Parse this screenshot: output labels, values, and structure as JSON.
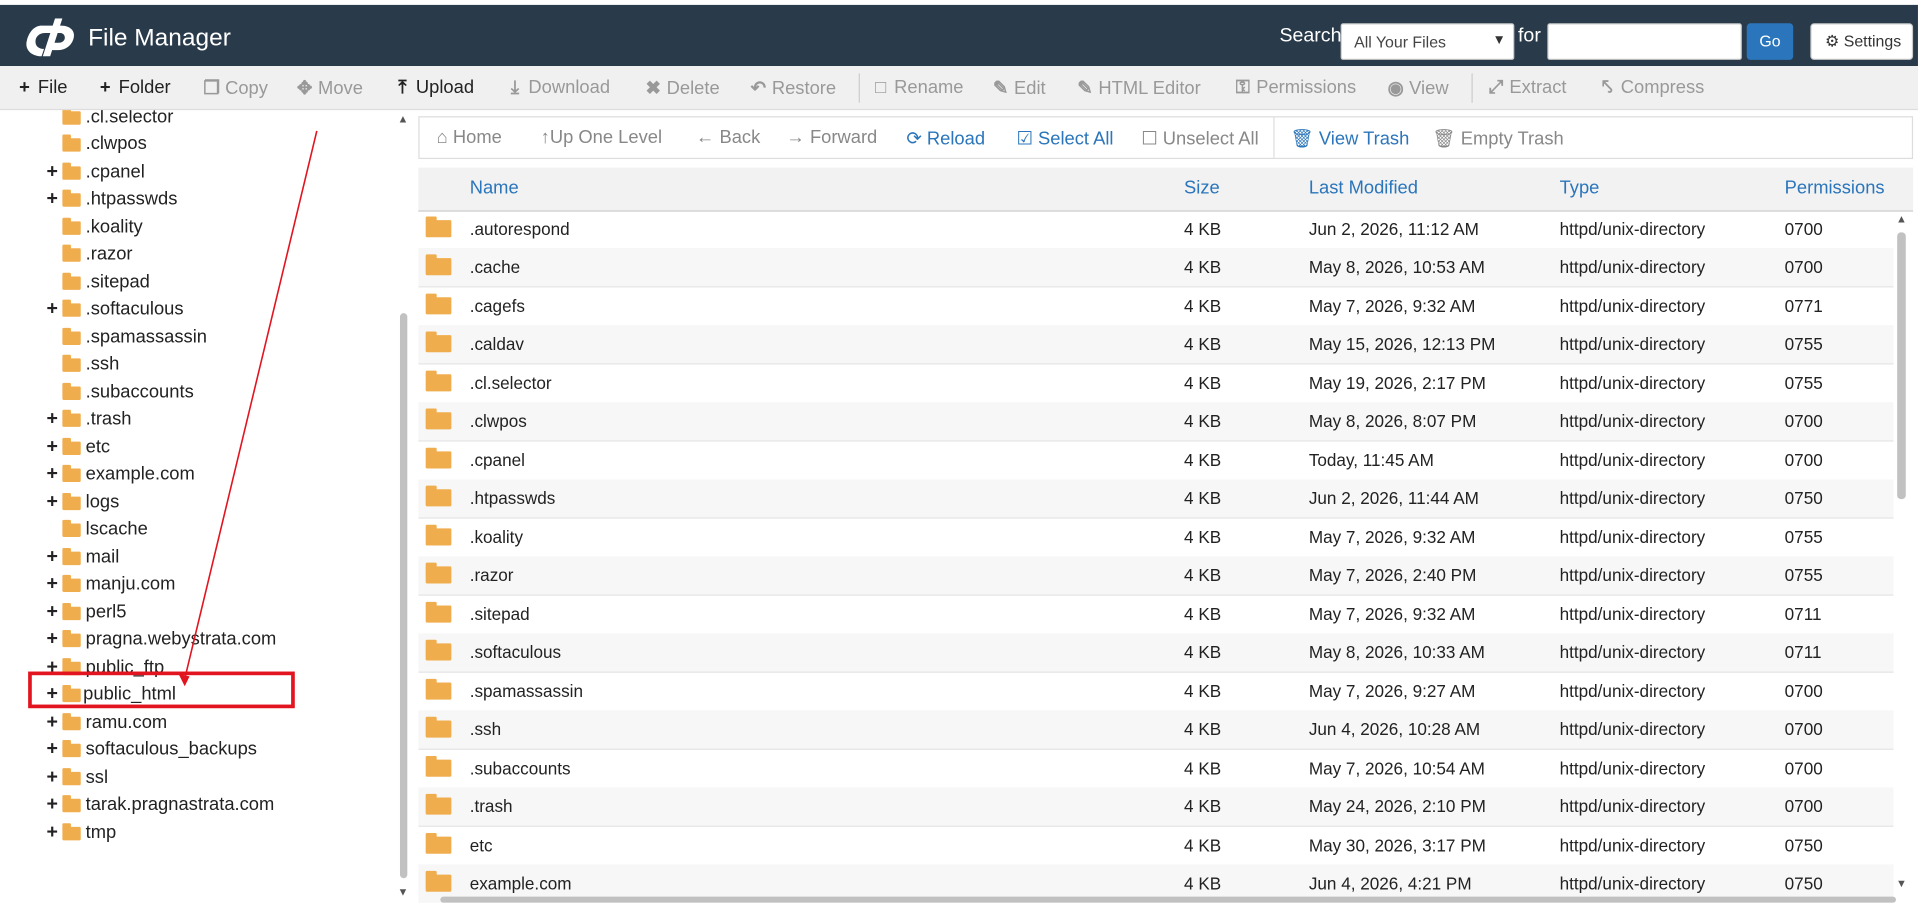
{
  "header": {
    "title": "File Manager",
    "search_label": "Search",
    "search_scope": "All Your Files",
    "for_label": "for",
    "search_value": "",
    "go_label": "Go",
    "settings_label": "Settings",
    "bg_color": "#293a4a"
  },
  "toolbar": {
    "items": [
      {
        "label": "File",
        "icon": "plus-icon"
      },
      {
        "label": "Folder",
        "icon": "plus-icon"
      },
      {
        "label": "Copy",
        "icon": "copy-icon"
      },
      {
        "label": "Move",
        "icon": "move-icon"
      },
      {
        "label": "Upload",
        "icon": "upload-icon"
      },
      {
        "label": "Download",
        "icon": "download-icon"
      },
      {
        "label": "Delete",
        "icon": "close-icon"
      },
      {
        "label": "Restore",
        "icon": "undo-icon"
      },
      {
        "label": "Rename",
        "icon": "file-icon"
      },
      {
        "label": "Edit",
        "icon": "pencil-icon"
      },
      {
        "label": "HTML Editor",
        "icon": "edit-icon"
      },
      {
        "label": "Permissions",
        "icon": "key-icon"
      },
      {
        "label": "View",
        "icon": "eye-icon"
      },
      {
        "label": "Extract",
        "icon": "expand-icon"
      },
      {
        "label": "Compress",
        "icon": "compress-icon"
      }
    ]
  },
  "tree": {
    "items": [
      {
        "label": ".cl.selector"
      },
      {
        "label": ".clwpos"
      },
      {
        "label": ".cpanel"
      },
      {
        "label": ".htpasswds"
      },
      {
        "label": ".koality"
      },
      {
        "label": ".razor"
      },
      {
        "label": ".sitepad"
      },
      {
        "label": ".softaculous"
      },
      {
        "label": ".spamassassin"
      },
      {
        "label": ".ssh"
      },
      {
        "label": ".subaccounts"
      },
      {
        "label": ".trash"
      },
      {
        "label": "etc"
      },
      {
        "label": "example.com"
      },
      {
        "label": "logs"
      },
      {
        "label": "lscache"
      },
      {
        "label": "mail"
      },
      {
        "label": "manju.com"
      },
      {
        "label": "perl5"
      },
      {
        "label": "pragna.webystrata.com"
      },
      {
        "label": "public_ftp"
      },
      {
        "label": "public_html"
      },
      {
        "label": "ramu.com"
      },
      {
        "label": "softaculous_backups"
      },
      {
        "label": "ssl"
      },
      {
        "label": "tarak.pragnastrata.com"
      },
      {
        "label": "tmp"
      }
    ]
  },
  "navbar": {
    "items": [
      {
        "label": "Home",
        "icon": "home-icon"
      },
      {
        "label": "Up One Level",
        "icon": "arrow-up-icon"
      },
      {
        "label": "Back",
        "icon": "arrow-left-icon"
      },
      {
        "label": "Forward",
        "icon": "arrow-right-icon"
      },
      {
        "label": "Reload",
        "icon": "reload-icon"
      },
      {
        "label": "Select All",
        "icon": "checkbox-checked-icon"
      },
      {
        "label": "Unselect All",
        "icon": "checkbox-empty-icon"
      },
      {
        "label": "View Trash",
        "icon": "trash-icon"
      },
      {
        "label": "Empty Trash",
        "icon": "trash-icon"
      }
    ]
  },
  "table": {
    "headers": [
      "Name",
      "Size",
      "Last Modified",
      "Type",
      "Permissions"
    ],
    "rows": [
      {
        "name": ".autorespond",
        "size": "4 KB",
        "modified": "Jun 2, 2026, 11:12 AM",
        "type": "httpd/unix-directory",
        "perms": "0700"
      },
      {
        "name": ".cache",
        "size": "4 KB",
        "modified": "May 8, 2026, 10:53 AM",
        "type": "httpd/unix-directory",
        "perms": "0700"
      },
      {
        "name": ".cagefs",
        "size": "4 KB",
        "modified": "May 7, 2026, 9:32 AM",
        "type": "httpd/unix-directory",
        "perms": "0771"
      },
      {
        "name": ".caldav",
        "size": "4 KB",
        "modified": "May 15, 2026, 12:13 PM",
        "type": "httpd/unix-directory",
        "perms": "0755"
      },
      {
        "name": ".cl.selector",
        "size": "4 KB",
        "modified": "May 19, 2026, 2:17 PM",
        "type": "httpd/unix-directory",
        "perms": "0755"
      },
      {
        "name": ".clwpos",
        "size": "4 KB",
        "modified": "May 8, 2026, 8:07 PM",
        "type": "httpd/unix-directory",
        "perms": "0700"
      },
      {
        "name": ".cpanel",
        "size": "4 KB",
        "modified": "Today, 11:45 AM",
        "type": "httpd/unix-directory",
        "perms": "0700"
      },
      {
        "name": ".htpasswds",
        "size": "4 KB",
        "modified": "Jun 2, 2026, 11:44 AM",
        "type": "httpd/unix-directory",
        "perms": "0750"
      },
      {
        "name": ".koality",
        "size": "4 KB",
        "modified": "May 7, 2026, 9:32 AM",
        "type": "httpd/unix-directory",
        "perms": "0755"
      },
      {
        "name": ".razor",
        "size": "4 KB",
        "modified": "May 7, 2026, 2:40 PM",
        "type": "httpd/unix-directory",
        "perms": "0755"
      },
      {
        "name": ".sitepad",
        "size": "4 KB",
        "modified": "May 7, 2026, 9:32 AM",
        "type": "httpd/unix-directory",
        "perms": "0711"
      },
      {
        "name": ".softaculous",
        "size": "4 KB",
        "modified": "May 8, 2026, 10:33 AM",
        "type": "httpd/unix-directory",
        "perms": "0711"
      },
      {
        "name": ".spamassassin",
        "size": "4 KB",
        "modified": "May 7, 2026, 9:27 AM",
        "type": "httpd/unix-directory",
        "perms": "0700"
      },
      {
        "name": ".ssh",
        "size": "4 KB",
        "modified": "Jun 4, 2026, 10:28 AM",
        "type": "httpd/unix-directory",
        "perms": "0700"
      },
      {
        "name": ".subaccounts",
        "size": "4 KB",
        "modified": "May 7, 2026, 10:54 AM",
        "type": "httpd/unix-directory",
        "perms": "0700"
      },
      {
        "name": ".trash",
        "size": "4 KB",
        "modified": "May 24, 2026, 2:10 PM",
        "type": "httpd/unix-directory",
        "perms": "0700"
      },
      {
        "name": "etc",
        "size": "4 KB",
        "modified": "May 30, 2026, 3:17 PM",
        "type": "httpd/unix-directory",
        "perms": "0750"
      },
      {
        "name": "example.com",
        "size": "4 KB",
        "modified": "Jun 4, 2026, 4:21 PM",
        "type": "httpd/unix-directory",
        "perms": "0750"
      }
    ]
  },
  "colors": {
    "accent": "#2a75bb",
    "folder": "#f0ad4e",
    "annotation": "#e1141f"
  }
}
